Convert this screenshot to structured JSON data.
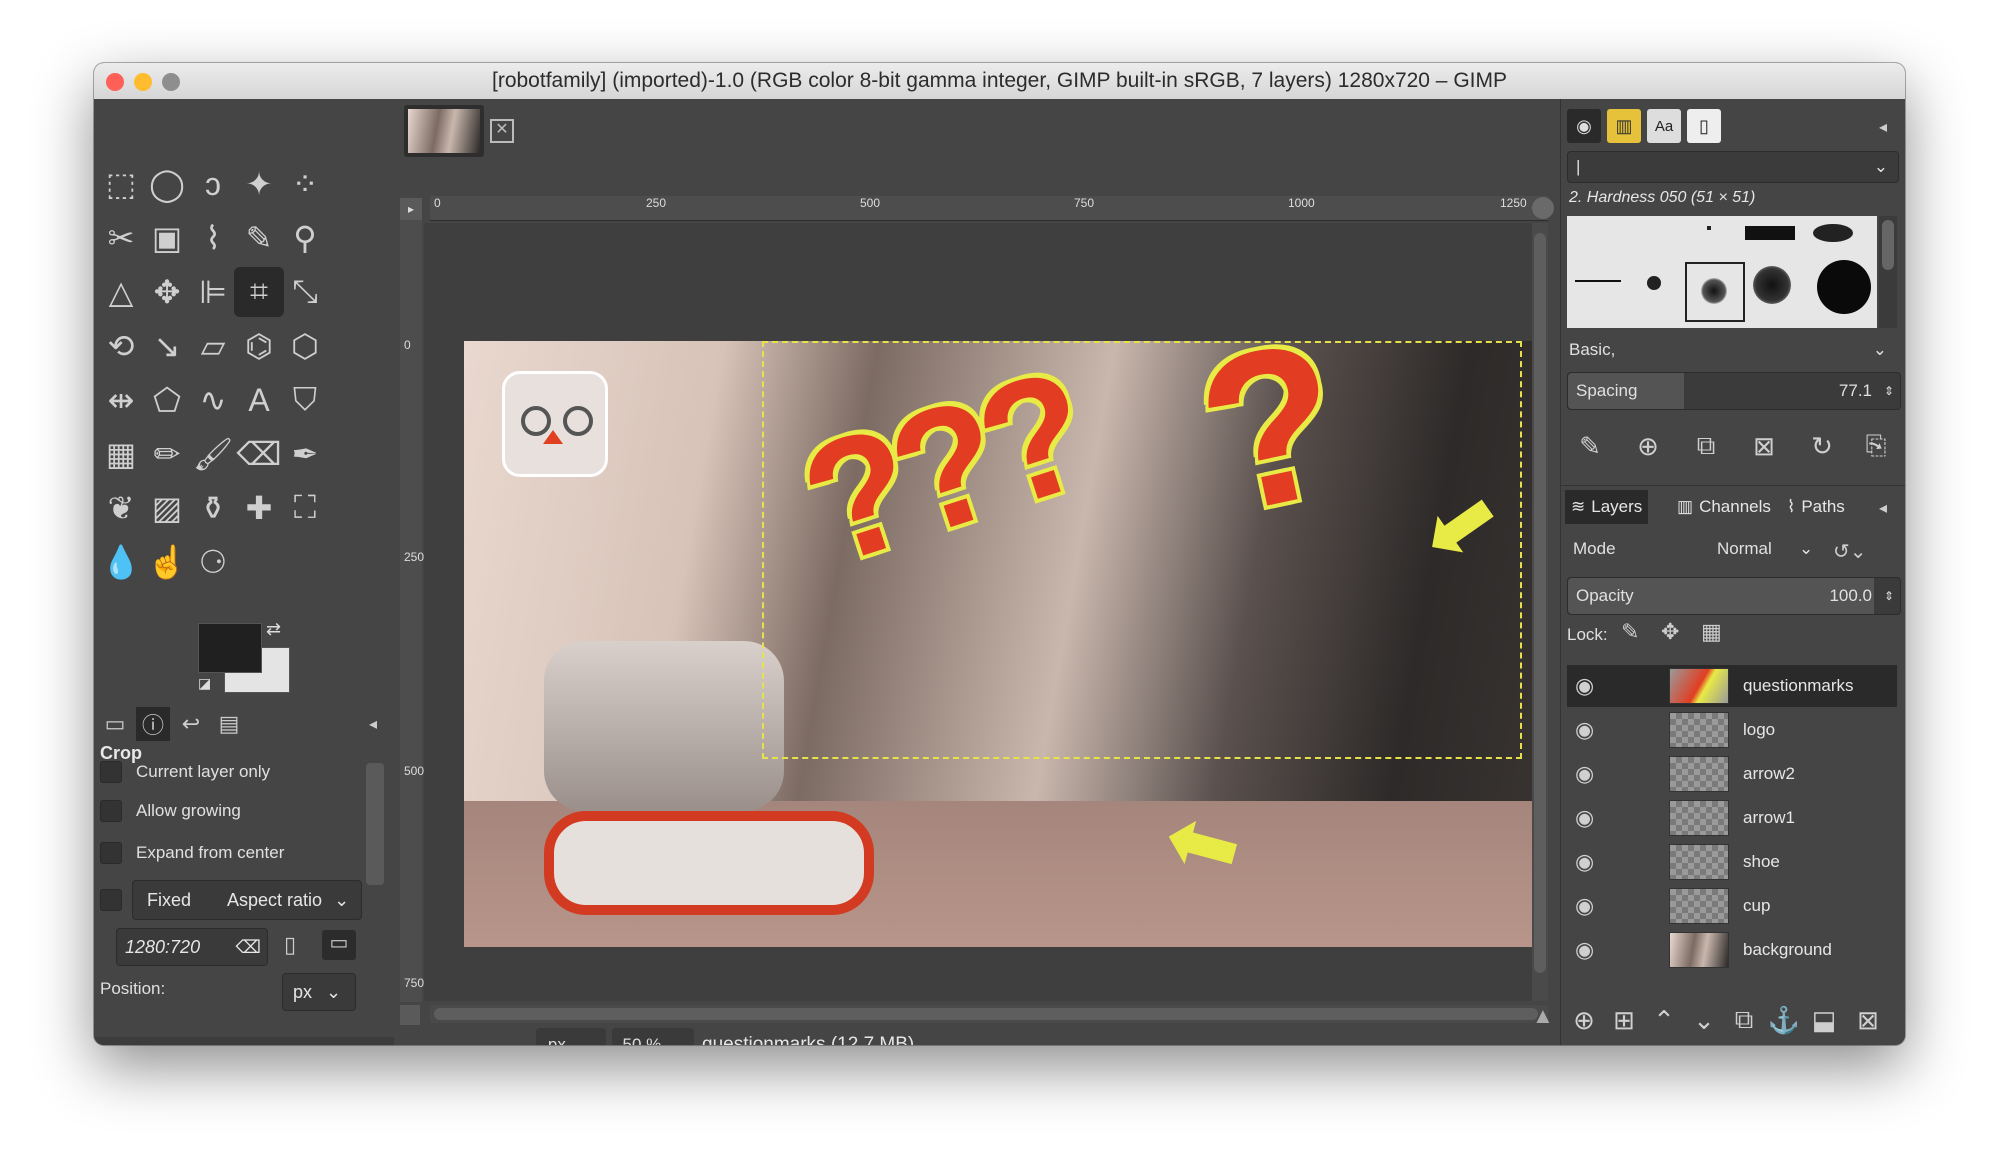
{
  "window": {
    "title": "[robotfamily] (imported)-1.0 (RGB color 8-bit gamma integer, GIMP built-in sRGB, 7 layers) 1280x720 – GIMP",
    "traffic_lights": [
      "#fe5f57",
      "#febc2e",
      "#8e8e8e"
    ]
  },
  "toolbox": {
    "tool_options_title": "Crop",
    "options": {
      "current_layer_only": "Current layer only",
      "allow_growing": "Allow growing",
      "expand_from_center": "Expand from center",
      "fixed": "Fixed",
      "fixed_mode": "Aspect ratio",
      "ratio_value": "1280:720",
      "position_label": "Position:",
      "position_unit": "px"
    }
  },
  "rulers": {
    "horizontal": [
      "0",
      "250",
      "500",
      "750",
      "1000",
      "1250"
    ],
    "vertical": [
      "0",
      "250",
      "500",
      "750"
    ]
  },
  "statusbar": {
    "unit": "px",
    "zoom": "50 %",
    "info": "questionmarks (12.7 MB)"
  },
  "brushes": {
    "selector_value": "|",
    "brush_name": "2. Hardness 050 (51 × 51)",
    "tag_filter": "Basic,",
    "spacing_label": "Spacing",
    "spacing_value": "77.1"
  },
  "layers_panel": {
    "tabs": [
      "Layers",
      "Channels",
      "Paths"
    ],
    "mode_label": "Mode",
    "mode_value": "Normal",
    "opacity_label": "Opacity",
    "opacity_value": "100.0",
    "lock_label": "Lock:",
    "layers": [
      "questionmarks",
      "logo",
      "arrow2",
      "arrow1",
      "shoe",
      "cup",
      "background"
    ],
    "selected_index": 0
  },
  "icons": {
    "eye": "eye-icon"
  }
}
